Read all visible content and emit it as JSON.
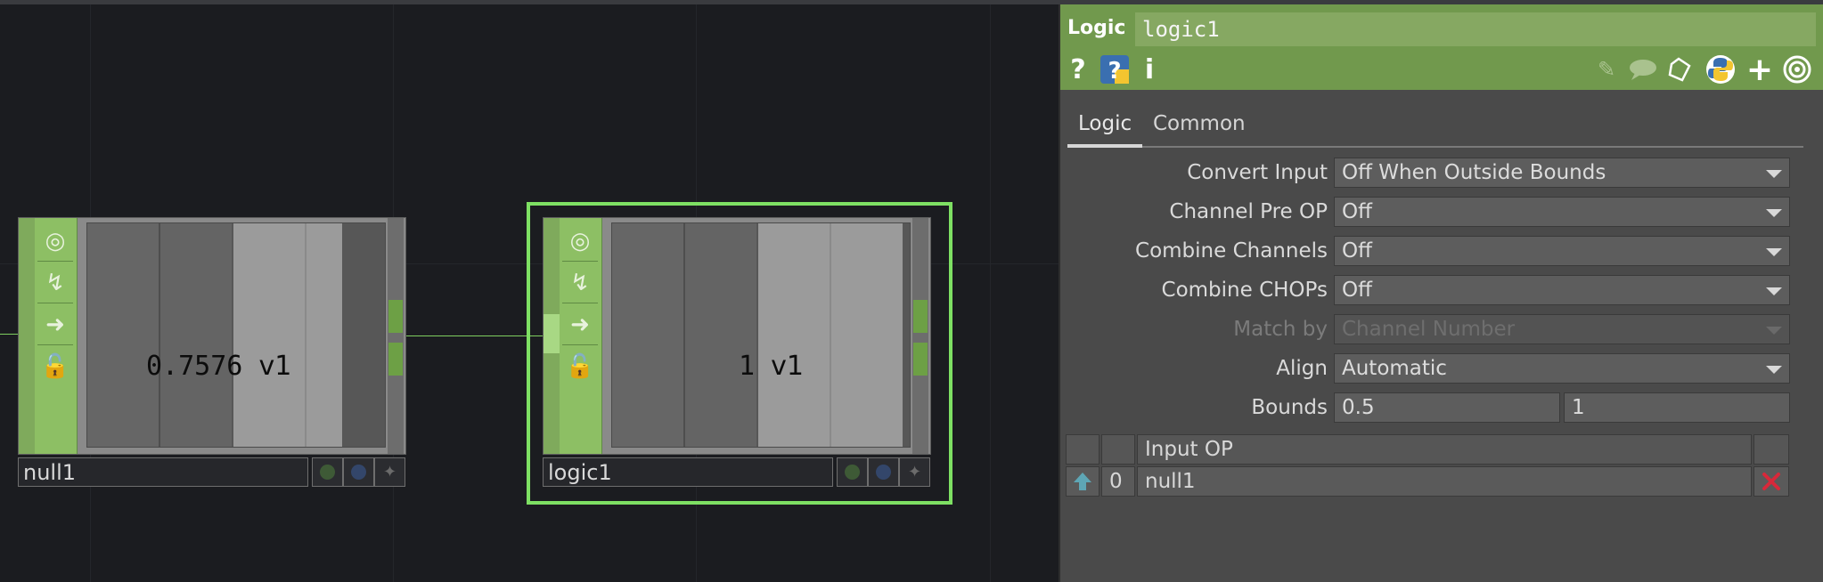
{
  "network": {
    "nodes": [
      {
        "name": "null1",
        "value": "0.7576",
        "flag": "v1"
      },
      {
        "name": "logic1",
        "value": "1",
        "flag": "v1"
      }
    ]
  },
  "panel": {
    "op_type": "Logic",
    "op_name": "logic1",
    "header_icons": [
      "help-icon",
      "python-help-icon",
      "info-icon",
      "edit-icon",
      "comment-icon",
      "clipboard-icon",
      "python-icon",
      "add-icon",
      "viewer-icon"
    ],
    "help_glyph": "?",
    "info_glyph": "i",
    "add_glyph": "+",
    "tabs": [
      "Logic",
      "Common"
    ],
    "params": [
      {
        "label": "Convert Input",
        "value": "Off When Outside Bounds",
        "type": "menu",
        "enabled": true
      },
      {
        "label": "Channel Pre OP",
        "value": "Off",
        "type": "menu",
        "enabled": true
      },
      {
        "label": "Combine Channels",
        "value": "Off",
        "type": "menu",
        "enabled": true
      },
      {
        "label": "Combine CHOPs",
        "value": "Off",
        "type": "menu",
        "enabled": true
      },
      {
        "label": "Match by",
        "value": "Channel Number",
        "type": "menu",
        "enabled": false
      },
      {
        "label": "Align",
        "value": "Automatic",
        "type": "menu",
        "enabled": true
      },
      {
        "label": "Bounds",
        "value1": "0.5",
        "value2": "1",
        "type": "pair",
        "enabled": true
      }
    ],
    "input_table": {
      "header": "Input OP",
      "rows": [
        {
          "index": "0",
          "op": "null1"
        }
      ]
    }
  },
  "colors": {
    "chop_green": "#8dbf64",
    "header_green": "#71994d",
    "selection": "#7ee063",
    "delete_red": "#d8283a"
  }
}
